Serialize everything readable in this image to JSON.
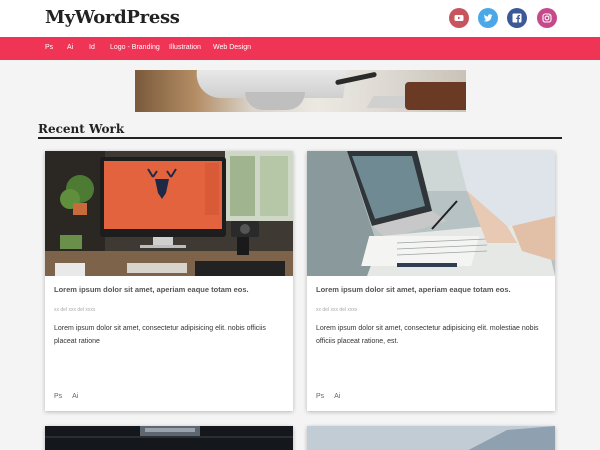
{
  "site": {
    "title": "MyWordPress"
  },
  "social": [
    {
      "name": "youtube",
      "icon": "youtube-icon",
      "color": "#c8555d"
    },
    {
      "name": "twitter",
      "icon": "twitter-icon",
      "color": "#4aa8e8"
    },
    {
      "name": "facebook",
      "icon": "facebook-icon",
      "color": "#3b5998"
    },
    {
      "name": "instagram",
      "icon": "instagram-icon",
      "color": "#c54a8b"
    }
  ],
  "nav": {
    "items": [
      "Ps",
      "Ai",
      "Id",
      "Logo - Branding",
      "Illustration",
      "Web Design"
    ],
    "color": "#ef3456"
  },
  "section": {
    "title": "Recent Work"
  },
  "cards": [
    {
      "title": "Lorem ipsum dolor sit amet, aperiam eaque totam eos.",
      "meta": "xx del xxx del xxxx",
      "body": "Lorem ipsum dolor sit amet, consectetur adipisicing elit. nobis officiis placeat ratione",
      "tags": [
        "Ps",
        "Ai"
      ]
    },
    {
      "title": "Lorem ipsum dolor sit amet, aperiam eaque totam eos.",
      "meta": "xx del xxx del xxxx",
      "body": "Lorem ipsum dolor sit amet, consectetur adipisicing elit. molestiae nobis officiis placeat ratione, est.",
      "tags": [
        "Ps",
        "Ai"
      ]
    }
  ]
}
